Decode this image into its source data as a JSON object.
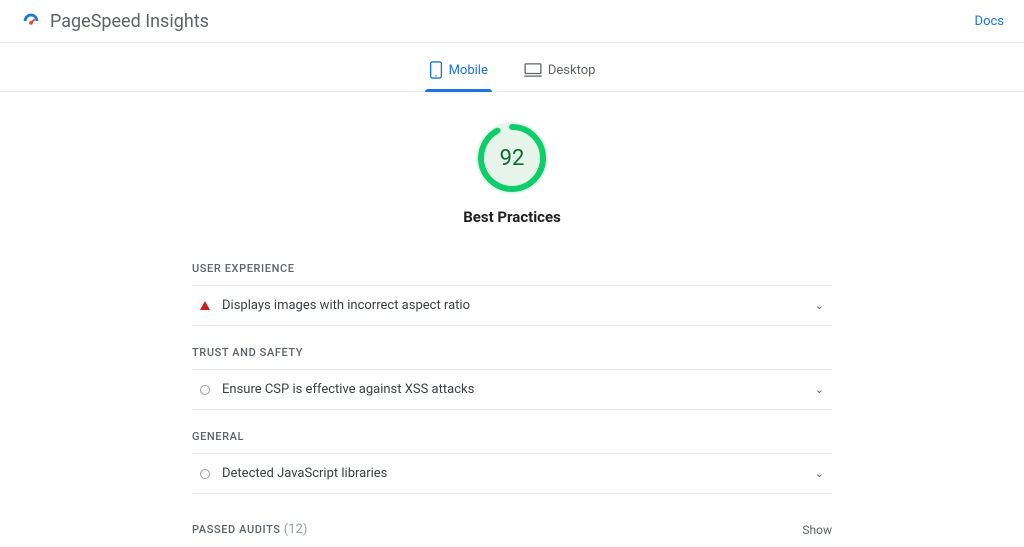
{
  "brand": {
    "title": "PageSpeed Insights"
  },
  "nav": {
    "docs": "Docs"
  },
  "tabs": {
    "mobile": "Mobile",
    "desktop": "Desktop",
    "active": "mobile"
  },
  "gauge": {
    "score": "92",
    "label": "Best Practices",
    "ring_color": "#0cce6b",
    "bg_color": "#e6f4ea",
    "pct": 92
  },
  "sections": {
    "user_experience": {
      "title": "USER EXPERIENCE",
      "items": [
        {
          "label": "Displays images with incorrect aspect ratio",
          "icon": "warn"
        }
      ]
    },
    "trust_safety": {
      "title": "TRUST AND SAFETY",
      "items": [
        {
          "label": "Ensure CSP is effective against XSS attacks",
          "icon": "neutral"
        }
      ]
    },
    "general": {
      "title": "GENERAL",
      "items": [
        {
          "label": "Detected JavaScript libraries",
          "icon": "neutral"
        }
      ]
    }
  },
  "passed": {
    "title": "PASSED AUDITS",
    "count": "(12)",
    "show": "Show"
  }
}
